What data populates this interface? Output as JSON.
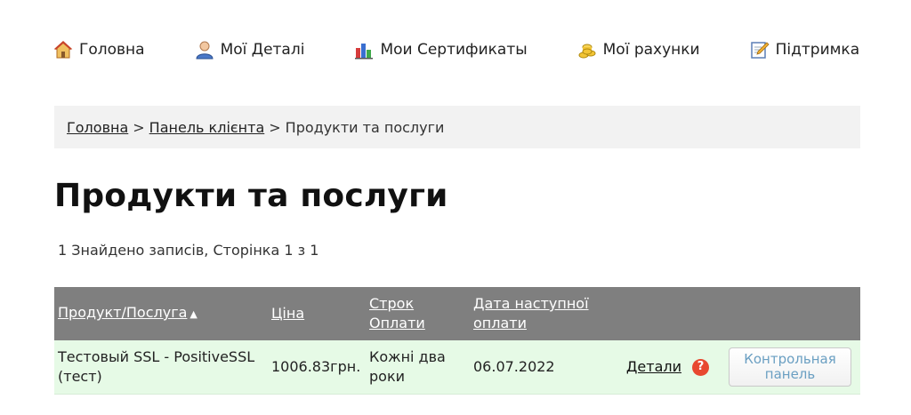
{
  "nav": {
    "items": [
      {
        "label": "Головна",
        "icon": "home-icon"
      },
      {
        "label": "Мої Деталі",
        "icon": "user-icon"
      },
      {
        "label": "Мои Сертификаты",
        "icon": "chart-icon"
      },
      {
        "label": "Мої рахунки",
        "icon": "coins-icon"
      },
      {
        "label": "Підтримка",
        "icon": "pencil-note-icon"
      }
    ]
  },
  "breadcrumb": {
    "items": [
      "Головна",
      "Панель клієнта",
      "Продукти та послуги"
    ],
    "separator": ">"
  },
  "page": {
    "title": "Продукти та послуги",
    "records_info": "1 Знайдено записів, Сторінка 1 з 1"
  },
  "table": {
    "headers": {
      "product": "Продукт/Послуга",
      "price": "Ціна",
      "term_line1": "Строк",
      "term_line2": "Оплати",
      "date_line1": "Дата наступної",
      "date_line2": "оплати",
      "sort_indicator": "▲"
    },
    "rows": [
      {
        "product_line1": "Тестовый SSL - PositiveSSL",
        "product_line2": "(тест)",
        "price": "1006.83грн.",
        "term_line1": "Кожні два",
        "term_line2": "роки",
        "next_date": "06.07.2022",
        "details_label": "Детали",
        "help_label": "?",
        "control_panel_line1": "Контрольная",
        "control_panel_line2": "панель"
      }
    ]
  },
  "colors": {
    "header_bg": "#7f7f7f",
    "row_bg": "#e6fae6",
    "breadcrumb_bg": "#f2f2f2",
    "help_red": "#e8482f",
    "button_text": "#6a9fc2"
  }
}
